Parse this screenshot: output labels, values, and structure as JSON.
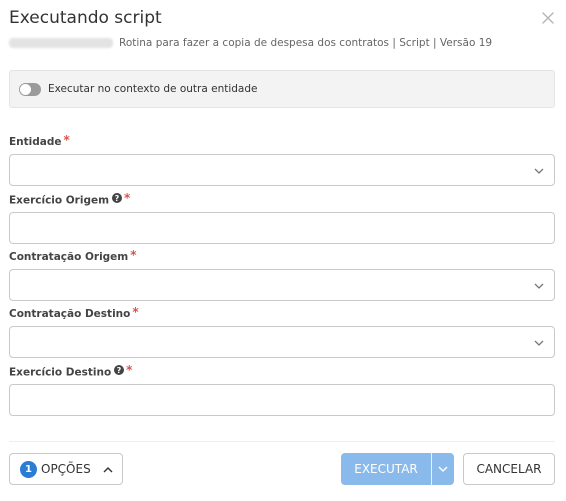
{
  "dialog": {
    "title": "Executando script",
    "subtitle": "Rotina para fazer a copia de despesa dos contratos | Script | Versão 19"
  },
  "context": {
    "toggle_label": "Executar no contexto de outra entidade",
    "toggle_on": false
  },
  "fields": [
    {
      "label": "Entidade",
      "type": "select",
      "value": "",
      "required": true,
      "help": false
    },
    {
      "label": "Exercício Origem",
      "type": "text",
      "value": "",
      "required": true,
      "help": true
    },
    {
      "label": "Contratação Origem",
      "type": "select",
      "value": "",
      "required": true,
      "help": false
    },
    {
      "label": "Contratação Destino",
      "type": "select",
      "value": "",
      "required": true,
      "help": false
    },
    {
      "label": "Exercício Destino",
      "type": "text",
      "value": "",
      "required": true,
      "help": true
    }
  ],
  "required_marker": "*",
  "footer": {
    "options_count": "1",
    "options_label": "OPÇÕES",
    "execute_label": "EXECUTAR",
    "cancel_label": "CANCELAR"
  },
  "icons": {
    "close": "close-icon",
    "help": "help-icon",
    "chevron": "chevron-down-icon"
  },
  "colors": {
    "primary": "#2b7cd3",
    "primary_disabled": "#8ab9ec",
    "required": "#d9534f",
    "toggle_off": "#9a9a9a"
  }
}
